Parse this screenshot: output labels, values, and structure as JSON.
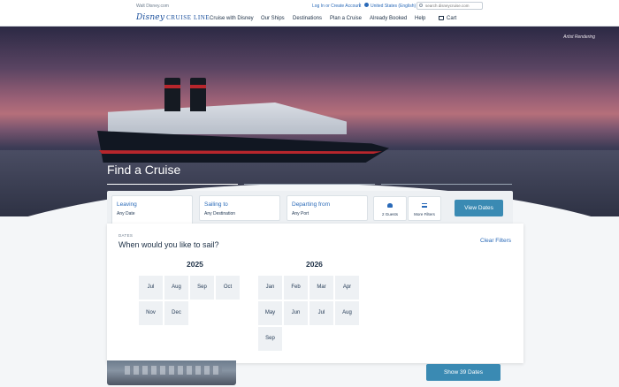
{
  "utility": {
    "wdw": "Walt Disney.com",
    "login": "Log In or Create Account",
    "separator": "|",
    "region": "United States (English)",
    "search_placeholder": "search disneycruise.com"
  },
  "nav": {
    "logo_disney": "Disney",
    "logo_cl": "CRUISE LINE",
    "items": [
      "Cruise with Disney",
      "Our Ships",
      "Destinations",
      "Plan a Cruise",
      "Already Booked",
      "Help",
      "Cart"
    ]
  },
  "hero": {
    "artist_note": "Artist Rendering",
    "title": "Find a Cruise"
  },
  "filters": {
    "leaving": {
      "label": "Leaving",
      "value": "Any Date"
    },
    "sailing": {
      "label": "Sailing to",
      "value": "Any Destination"
    },
    "departing": {
      "label": "Departing from",
      "value": "Any Port"
    },
    "guests": "2 Guests",
    "more_filters": "More Filters",
    "view_dates": "View Dates"
  },
  "dates_panel": {
    "caption": "DATES",
    "title": "When would you like to sail?",
    "clear": "Clear Filters",
    "years": [
      {
        "year": "2025",
        "months": [
          "Jul",
          "Aug",
          "Sep",
          "Oct",
          "Nov",
          "Dec"
        ]
      },
      {
        "year": "2026",
        "months": [
          "Jan",
          "Feb",
          "Mar",
          "Apr",
          "May",
          "Jun",
          "Jul",
          "Aug",
          "Sep"
        ]
      }
    ]
  },
  "results": {
    "show_button": "Show 39 Dates"
  },
  "colors": {
    "accent": "#2a6ab8",
    "button": "#3a8ab3",
    "navy": "#1c2f45"
  }
}
